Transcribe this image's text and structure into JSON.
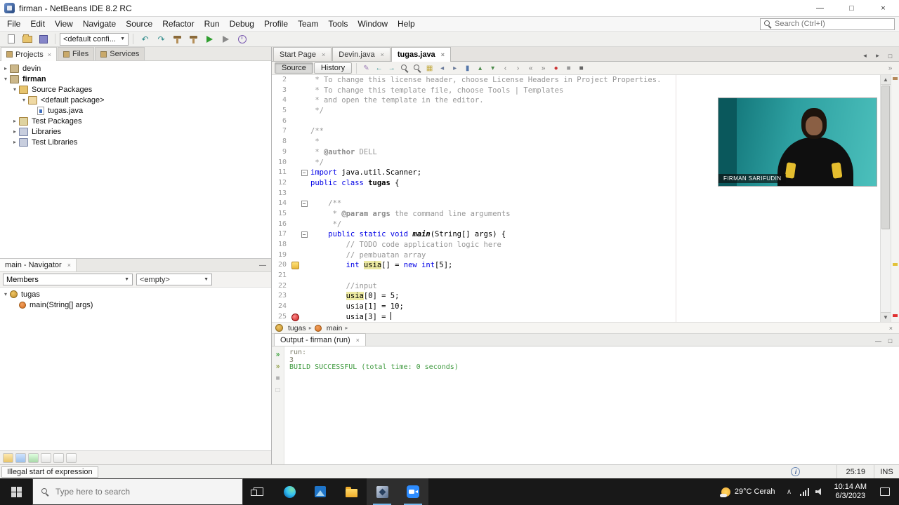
{
  "titlebar": {
    "title": "firman - NetBeans IDE 8.2 RC",
    "controls": [
      {
        "name": "minimize-button",
        "g": "—"
      },
      {
        "name": "maximize-button",
        "g": "□"
      },
      {
        "name": "close-button",
        "g": "×"
      }
    ]
  },
  "menubar": {
    "items": [
      "File",
      "Edit",
      "View",
      "Navigate",
      "Source",
      "Refactor",
      "Run",
      "Debug",
      "Profile",
      "Team",
      "Tools",
      "Window",
      "Help"
    ],
    "search_placeholder": "Search (Ctrl+I)"
  },
  "main_toolbar": {
    "config_value": "<default confi...",
    "icons_before": [
      {
        "name": "new-file-icon",
        "kind": "page"
      },
      {
        "name": "open-project-icon",
        "kind": "folder"
      },
      {
        "name": "save-all-icon",
        "kind": "floppy"
      }
    ],
    "icons_after": [
      {
        "name": "undo-icon",
        "kind": "glyph",
        "g": "↶",
        "col": "#2e8b8b"
      },
      {
        "name": "redo-icon",
        "kind": "glyph",
        "g": "↷",
        "col": "#2e8b8b"
      },
      {
        "name": "build-project-icon",
        "kind": "hammer"
      },
      {
        "name": "clean-build-project-icon",
        "kind": "hammer"
      },
      {
        "name": "run-project-icon",
        "kind": "play",
        "col": "#2f9e2f"
      },
      {
        "name": "debug-project-icon",
        "kind": "play",
        "col": "#8a8a8a"
      },
      {
        "name": "profile-project-icon",
        "kind": "clock"
      }
    ]
  },
  "projects_panel": {
    "tabs": [
      {
        "label": "Projects",
        "active": true,
        "closable": true
      },
      {
        "label": "Files"
      },
      {
        "label": "Services"
      }
    ],
    "tree": [
      {
        "label": "devin",
        "level": 0,
        "icon": "project-icon",
        "expander": "collapsed"
      },
      {
        "label": "firman",
        "level": 0,
        "icon": "project-icon",
        "expander": "expanded",
        "bold": true
      },
      {
        "label": "Source Packages",
        "level": 1,
        "icon": "source-folder-icon",
        "expander": "expanded"
      },
      {
        "label": "<default package>",
        "level": 2,
        "icon": "package-icon",
        "expander": "expanded"
      },
      {
        "label": "tugas.java",
        "level": 3,
        "icon": "java-file-icon",
        "expander": "none"
      },
      {
        "label": "Test Packages",
        "level": 1,
        "icon": "test-folder-icon",
        "expander": "collapsed"
      },
      {
        "label": "Libraries",
        "level": 1,
        "icon": "libraries-icon",
        "expander": "collapsed"
      },
      {
        "label": "Test Libraries",
        "level": 1,
        "icon": "libraries-icon",
        "expander": "collapsed"
      }
    ]
  },
  "navigator": {
    "tab_label": "main - Navigator",
    "close_glyph": "×",
    "minimize_glyph": "—",
    "members_label": "Members",
    "filter_value": "<empty>",
    "tree": [
      {
        "label": "tugas",
        "level": 0,
        "icon": "class-icon",
        "expander": "expanded"
      },
      {
        "label": "main(String[] args)",
        "level": 1,
        "icon": "method-icon",
        "expander": "none"
      }
    ],
    "footer_icons": [
      "show-inherited-icon",
      "show-fields-icon",
      "show-static-members-icon",
      "show-public-only-icon",
      "sort-alphabetically-icon",
      "sort-by-source-icon"
    ]
  },
  "editor": {
    "tabs": [
      {
        "label": "Start Page"
      },
      {
        "label": "Devin.java"
      },
      {
        "label": "tugas.java",
        "active": true
      }
    ],
    "tab_controls": [
      {
        "name": "scroll-tabs-left-icon",
        "g": "◂"
      },
      {
        "name": "scroll-tabs-right-icon",
        "g": "▸"
      },
      {
        "name": "maximize-editor-icon",
        "g": "□"
      }
    ],
    "view_buttons": [
      {
        "label": "Source",
        "active": true
      },
      {
        "label": "History"
      }
    ],
    "toolbar_icons": [
      {
        "name": "last-edit-position-icon",
        "g": "✎",
        "col": "#9a7ab5"
      },
      {
        "name": "back-icon",
        "g": "←",
        "col": "#2e8b8b"
      },
      {
        "name": "forward-icon",
        "g": "→",
        "col": "#2e8b8b"
      },
      {
        "name": "find-icon",
        "kind": "mag"
      },
      {
        "name": "find-selection-icon",
        "kind": "mag"
      },
      {
        "name": "toggle-highlight-icon",
        "g": "▦",
        "col": "#c2a83a"
      },
      {
        "name": "previous-bookmark-icon",
        "g": "◂",
        "col": "#6a7a9a"
      },
      {
        "name": "next-bookmark-icon",
        "g": "▸",
        "col": "#6a7a9a"
      },
      {
        "name": "toggle-bookmark-icon",
        "g": "▮",
        "col": "#5577aa"
      },
      {
        "name": "previous-usage-icon",
        "g": "▴",
        "col": "#4a8a4a"
      },
      {
        "name": "next-usage-icon",
        "g": "▾",
        "col": "#4a8a4a"
      },
      {
        "name": "comment-icon",
        "g": "‹",
        "col": "#777777"
      },
      {
        "name": "uncomment-icon",
        "g": "›",
        "col": "#777777"
      },
      {
        "name": "indent-left-icon",
        "g": "«",
        "col": "#777777"
      },
      {
        "name": "indent-right-icon",
        "g": "»",
        "col": "#777777"
      },
      {
        "name": "breakpoint-icon",
        "g": "●",
        "col": "#cc3333"
      },
      {
        "name": "start-macro-icon",
        "g": "■",
        "col": "#999999"
      },
      {
        "name": "stop-macro-icon",
        "g": "■",
        "col": "#666666"
      }
    ],
    "overflow_glyph": "»",
    "breadcrumb": [
      {
        "label": "tugas",
        "icon": "class-icon"
      },
      {
        "label": "main",
        "icon": "method-icon"
      }
    ],
    "code_lines": [
      {
        "n": 2,
        "s": [
          {
            "t": " * To change this license header, choose License Headers in Project Properties.",
            "c": "com"
          }
        ]
      },
      {
        "n": 3,
        "s": [
          {
            "t": " * To change this template file, choose Tools | Templates",
            "c": "com"
          }
        ]
      },
      {
        "n": 4,
        "s": [
          {
            "t": " * and open the template in the editor.",
            "c": "com"
          }
        ]
      },
      {
        "n": 5,
        "s": [
          {
            "t": " */",
            "c": "com"
          }
        ]
      },
      {
        "n": 6,
        "s": []
      },
      {
        "n": 7,
        "s": [
          {
            "t": "/**",
            "c": "com"
          }
        ]
      },
      {
        "n": 8,
        "s": [
          {
            "t": " *",
            "c": "com"
          }
        ]
      },
      {
        "n": 9,
        "s": [
          {
            "t": " * ",
            "c": "com"
          },
          {
            "t": "@author",
            "c": "doc"
          },
          {
            "t": " DELL",
            "c": "com"
          }
        ]
      },
      {
        "n": 10,
        "s": [
          {
            "t": " */",
            "c": "com"
          }
        ]
      },
      {
        "n": 11,
        "fold": true,
        "s": [
          {
            "t": "import",
            "c": "kw"
          },
          {
            "t": " java.util.Scanner;",
            "c": "pl"
          }
        ]
      },
      {
        "n": 12,
        "s": [
          {
            "t": "public class",
            "c": "kw"
          },
          {
            "t": " ",
            "c": "pl"
          },
          {
            "t": "tugas",
            "c": "decl"
          },
          {
            "t": " {",
            "c": "pl"
          }
        ]
      },
      {
        "n": 13,
        "s": []
      },
      {
        "n": 14,
        "fold": true,
        "s": [
          {
            "t": "    /**",
            "c": "com"
          }
        ]
      },
      {
        "n": 15,
        "s": [
          {
            "t": "     * ",
            "c": "com"
          },
          {
            "t": "@param",
            "c": "doc"
          },
          {
            "t": " ",
            "c": "com"
          },
          {
            "t": "args",
            "c": "doc"
          },
          {
            "t": " the command line arguments",
            "c": "com"
          }
        ]
      },
      {
        "n": 16,
        "s": [
          {
            "t": "     */",
            "c": "com"
          }
        ]
      },
      {
        "n": 17,
        "fold": true,
        "s": [
          {
            "t": "    ",
            "c": "pl"
          },
          {
            "t": "public static void",
            "c": "kw"
          },
          {
            "t": " ",
            "c": "pl"
          },
          {
            "t": "main",
            "c": "decl-static"
          },
          {
            "t": "(String[] args) {",
            "c": "pl"
          }
        ]
      },
      {
        "n": 18,
        "s": [
          {
            "t": "        ",
            "c": "pl"
          },
          {
            "t": "// TODO code application logic here",
            "c": "com"
          }
        ]
      },
      {
        "n": 19,
        "s": [
          {
            "t": "        ",
            "c": "pl"
          },
          {
            "t": "// pembuatan array",
            "c": "com"
          }
        ]
      },
      {
        "n": 20,
        "glyph": "warning",
        "s": [
          {
            "t": "        ",
            "c": "pl"
          },
          {
            "t": "int",
            "c": "kw"
          },
          {
            "t": " ",
            "c": "pl"
          },
          {
            "t": "usia",
            "c": "hl"
          },
          {
            "t": "[] = ",
            "c": "pl"
          },
          {
            "t": "new",
            "c": "kw"
          },
          {
            "t": " ",
            "c": "pl"
          },
          {
            "t": "int",
            "c": "kw"
          },
          {
            "t": "[5];",
            "c": "pl"
          }
        ]
      },
      {
        "n": 21,
        "s": []
      },
      {
        "n": 22,
        "s": [
          {
            "t": "        ",
            "c": "pl"
          },
          {
            "t": "//input",
            "c": "com"
          }
        ]
      },
      {
        "n": 23,
        "s": [
          {
            "t": "        ",
            "c": "pl"
          },
          {
            "t": "usia",
            "c": "hl"
          },
          {
            "t": "[0] = 5;",
            "c": "pl"
          }
        ]
      },
      {
        "n": 24,
        "s": [
          {
            "t": "        ",
            "c": "pl"
          },
          {
            "t": "usia",
            "c": "pl"
          },
          {
            "t": "[1] = 10;",
            "c": "pl"
          }
        ]
      },
      {
        "n": 25,
        "glyph": "error",
        "s": [
          {
            "t": "        usia[3] = ",
            "c": "pl"
          },
          {
            "t": "",
            "c": "caret"
          }
        ]
      }
    ]
  },
  "output": {
    "tab_label": "Output - firman (run)",
    "controls": [
      {
        "name": "minimize-output-icon",
        "g": "—"
      },
      {
        "name": "restore-output-icon",
        "g": "□"
      }
    ],
    "strip_icons": [
      {
        "name": "rerun-icon",
        "g": "»",
        "col": "#2f9e2f"
      },
      {
        "name": "rerun-debug-icon",
        "g": "»",
        "col": "#8a9a3f"
      },
      {
        "name": "stop-run-icon",
        "g": "■",
        "col": "#b0b0b0"
      },
      {
        "name": "clear-output-icon",
        "g": "□",
        "col": "#b0b0b0"
      }
    ],
    "lines": [
      {
        "t": "run:",
        "c": "muted"
      },
      {
        "t": "3",
        "c": "muted"
      },
      {
        "t": "BUILD SUCCESSFUL (total time: 0 seconds)",
        "c": "success"
      }
    ]
  },
  "statusbar": {
    "message": "Illegal start of expression",
    "caret_position": "25:19",
    "insert_mode": "INS"
  },
  "taskbar": {
    "search_placeholder": "Type here to search",
    "weather": "29°C Cerah",
    "time": "10:14 AM",
    "date": "6/3/2023",
    "apps": [
      {
        "name": "task-view-button",
        "kind": "taskview"
      },
      {
        "name": "edge-button",
        "kind": "edge"
      },
      {
        "name": "photos-button",
        "kind": "photos"
      },
      {
        "name": "file-explorer-button",
        "kind": "explorer"
      },
      {
        "name": "netbeans-button",
        "kind": "netbeans",
        "active": true
      },
      {
        "name": "zoom-button",
        "kind": "zoom",
        "active": true
      }
    ]
  },
  "webcam": {
    "name_label": "FIRMAN SARIFUDIN"
  }
}
